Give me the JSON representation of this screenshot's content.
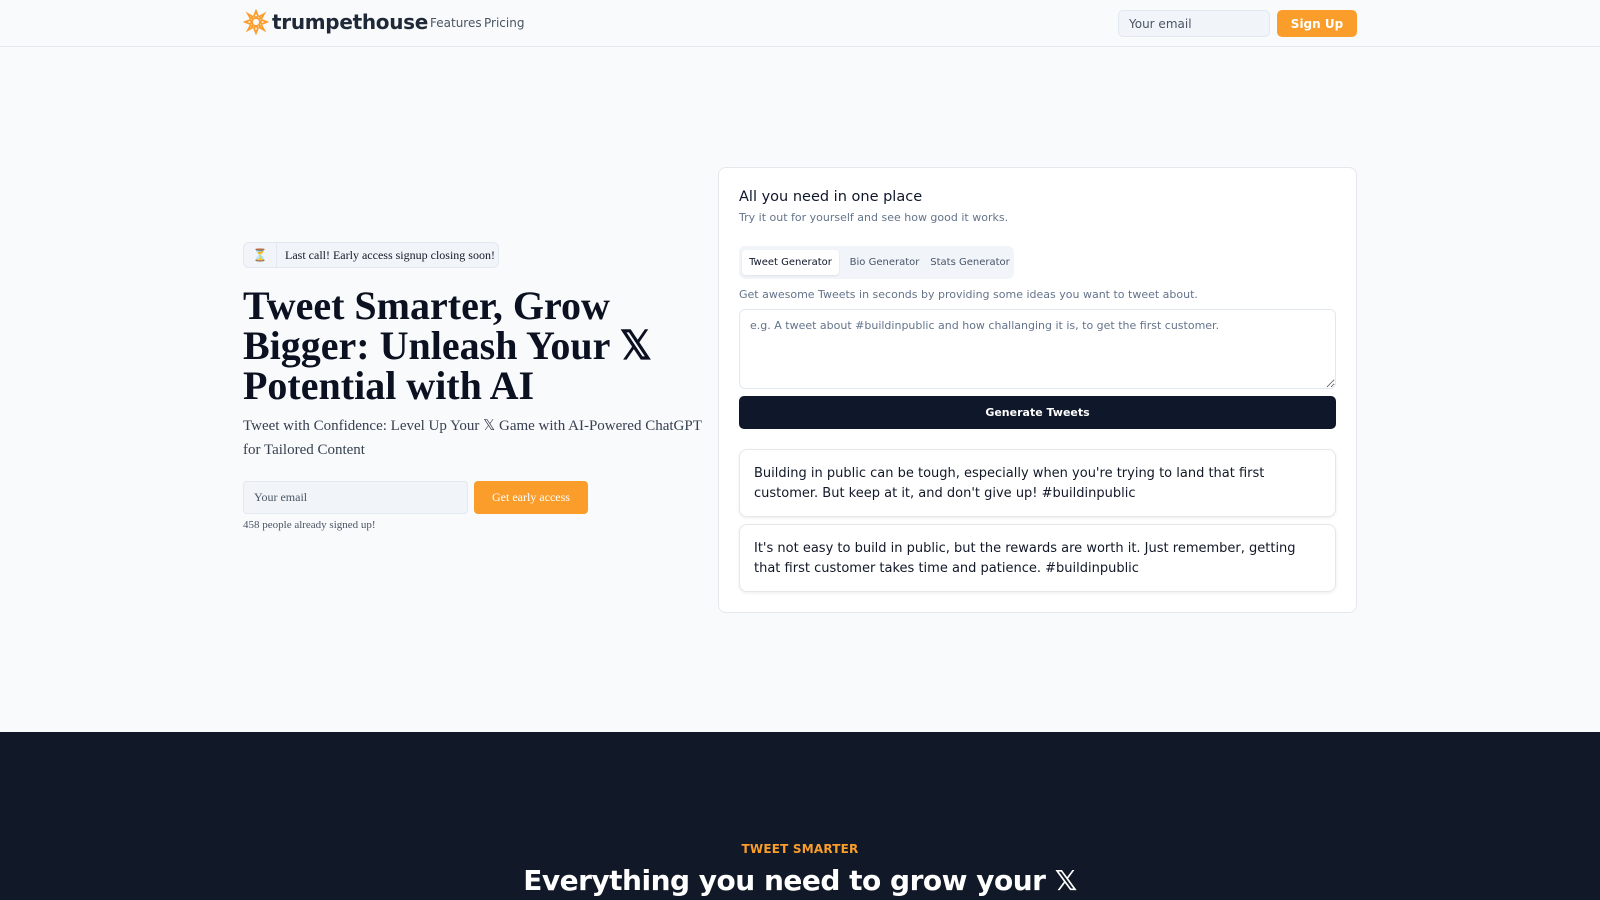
{
  "header": {
    "brand": "trumpethouse",
    "nav": {
      "features": "Features",
      "pricing": "Pricing"
    },
    "email_placeholder": "Your email",
    "signup_label": "Sign Up"
  },
  "hero": {
    "badge_icon": "hourglass-icon",
    "badge_text": "Last call! Early access signup closing soon!",
    "title": "Tweet Smarter, Grow Bigger: Unleash Your 𝕏 Potential with AI",
    "subtitle": "Tweet with Confidence: Level Up Your 𝕏 Game with AI-Powered ChatGPT for Tailored Content",
    "email_placeholder": "Your email",
    "cta_label": "Get early access",
    "signup_count_text": "458 people already signed up!"
  },
  "demo": {
    "title": "All you need in one place",
    "subtitle": "Try it out for yourself and see how good it works.",
    "tabs": [
      {
        "label": "Tweet Generator",
        "active": true
      },
      {
        "label": "Bio Generator",
        "active": false
      },
      {
        "label": "Stats Generator",
        "active": false
      }
    ],
    "description": "Get awesome Tweets in seconds by providing some ideas you want to tweet about.",
    "input_placeholder": "e.g. A tweet about #buildinpublic and how challanging it is, to get the first customer.",
    "generate_label": "Generate Tweets",
    "results": [
      "Building in public can be tough, especially when you're trying to land that first customer. But keep at it, and don't give up! #buildinpublic",
      "It's not easy to build in public, but the rewards are worth it. Just remember, getting that first customer takes time and patience. #buildinpublic"
    ]
  },
  "features_section": {
    "eyebrow": "TWEET SMARTER",
    "title": "Everything you need to grow your 𝕏"
  },
  "colors": {
    "accent": "#fb9d2b",
    "dark": "#111827",
    "button_dark": "#0f172a",
    "background": "#f8fafc"
  }
}
